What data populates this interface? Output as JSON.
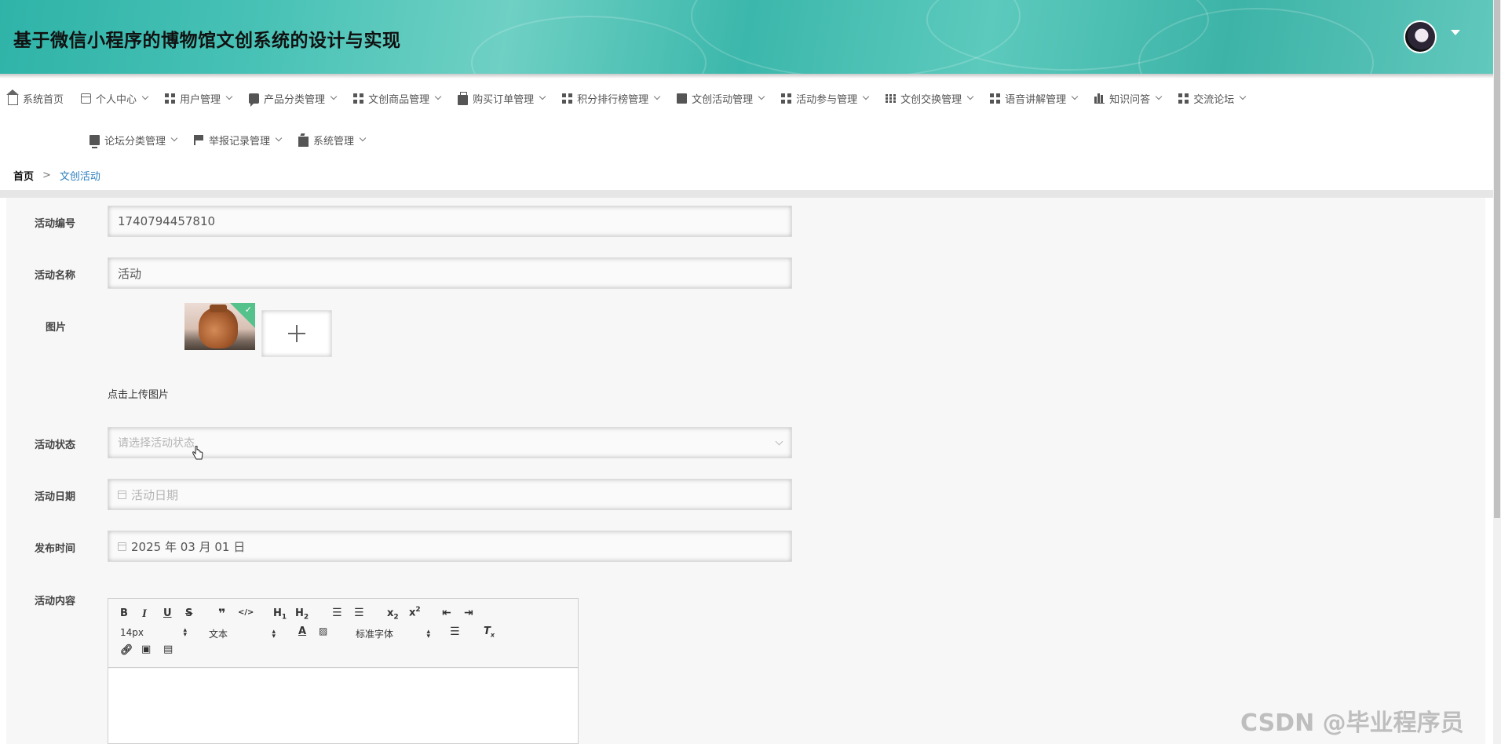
{
  "header": {
    "title": "基于微信小程序的博物馆文创系统的设计与实现",
    "avatar_icon": "user-avatar",
    "dropdown_icon": "caret-down-icon",
    "brand_color": "#3cb7ab"
  },
  "menu": {
    "row1": [
      {
        "label": "系统首页",
        "icon": "home-icon",
        "dropdown": false
      },
      {
        "label": "个人中心",
        "icon": "id-card-icon",
        "dropdown": true
      },
      {
        "label": "用户管理",
        "icon": "grid-icon",
        "dropdown": true
      },
      {
        "label": "产品分类管理",
        "icon": "comment-icon",
        "dropdown": true
      },
      {
        "label": "文创商品管理",
        "icon": "grid-icon",
        "dropdown": true
      },
      {
        "label": "购买订单管理",
        "icon": "shopping-bag-icon",
        "dropdown": true
      },
      {
        "label": "积分排行榜管理",
        "icon": "grid-icon",
        "dropdown": true
      },
      {
        "label": "文创活动管理",
        "icon": "clipboard-icon",
        "dropdown": true
      },
      {
        "label": "活动参与管理",
        "icon": "grid-icon",
        "dropdown": true
      },
      {
        "label": "文创交换管理",
        "icon": "table-icon",
        "dropdown": true
      },
      {
        "label": "语音讲解管理",
        "icon": "grid-icon",
        "dropdown": true
      },
      {
        "label": "知识问答",
        "icon": "bar-chart-icon",
        "dropdown": true
      },
      {
        "label": "交流论坛",
        "icon": "grid-icon",
        "dropdown": true
      }
    ],
    "row2": [
      {
        "label": "论坛分类管理",
        "icon": "monitor-icon",
        "dropdown": true
      },
      {
        "label": "举报记录管理",
        "icon": "flag-icon",
        "dropdown": true
      },
      {
        "label": "系统管理",
        "icon": "briefcase-icon",
        "dropdown": true
      }
    ]
  },
  "breadcrumb": {
    "home": "首页",
    "separator": ">",
    "current": "文创活动",
    "current_color": "#2e80c0"
  },
  "form": {
    "activity_id": {
      "label": "活动编号",
      "value": "1740794457810"
    },
    "activity_name": {
      "label": "活动名称",
      "value": "活动"
    },
    "image": {
      "label": "图片",
      "upload_tip": "点击上传图片",
      "uploaded_count": 1
    },
    "activity_status": {
      "label": "活动状态",
      "placeholder": "请选择活动状态",
      "value": ""
    },
    "activity_date": {
      "label": "活动日期",
      "placeholder": "活动日期",
      "value": ""
    },
    "publish_time": {
      "label": "发布时间",
      "value": "2025 年 03 月 01 日"
    },
    "activity_content": {
      "label": "活动内容"
    }
  },
  "editor": {
    "font_size": "14px",
    "header_style": "文本",
    "font_family": "标准字体",
    "buttons": [
      "B",
      "I",
      "U",
      "S",
      "❞",
      "</>",
      "H1",
      "H2",
      "ordered-list",
      "bullet-list",
      "x₂",
      "x²",
      "outdent",
      "indent",
      "font-color",
      "background-color",
      "align",
      "clear-format",
      "link",
      "image",
      "video"
    ]
  },
  "watermark": "CSDN @毕业程序员"
}
